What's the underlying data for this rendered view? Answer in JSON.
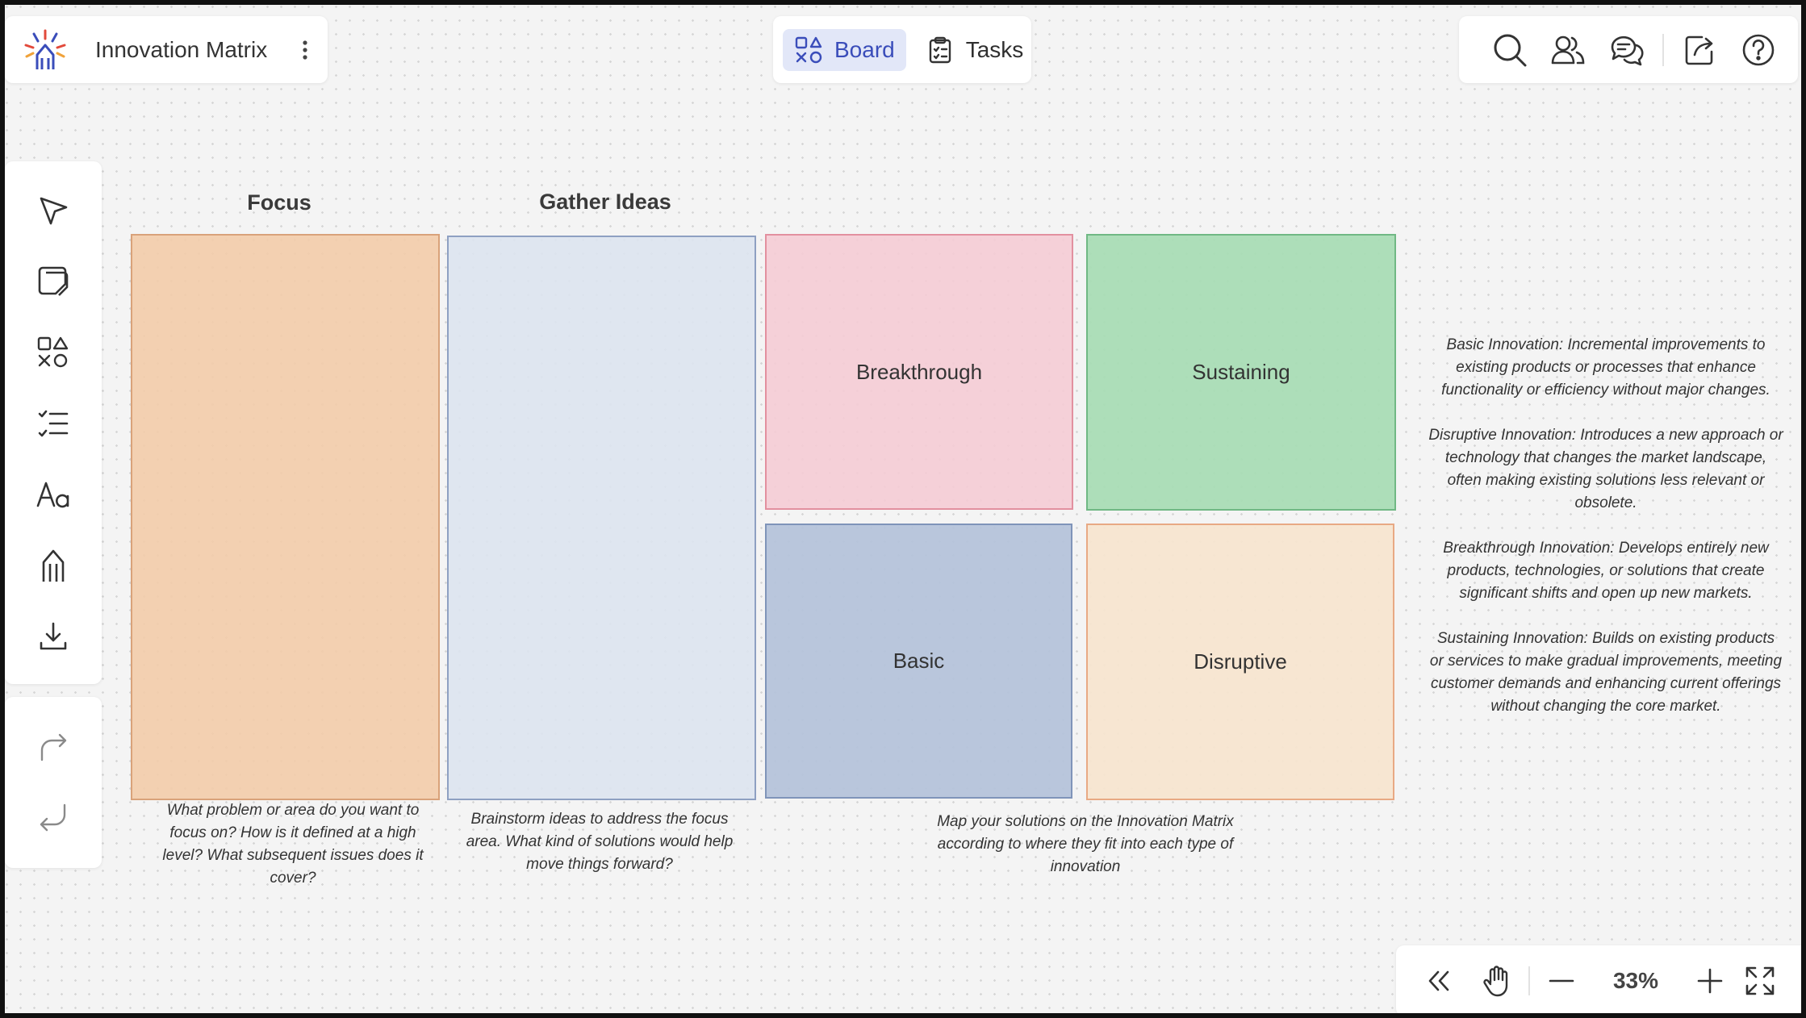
{
  "app": {
    "title": "Innovation Matrix"
  },
  "tabs": [
    {
      "label": "Board",
      "active": true
    },
    {
      "label": "Tasks",
      "active": false
    }
  ],
  "colors": {
    "accent": "#3a4dba",
    "tab_active_bg": "#e2e7f8",
    "focus_fill": "#f2ccaa",
    "gather_fill": "#dce4ef",
    "breakthrough_fill": "#f4ccd5",
    "sustaining_fill": "#a9dcb5",
    "basic_fill": "#b5c3da",
    "disruptive_fill": "#f7e5d0"
  },
  "board": {
    "headings": {
      "focus": "Focus",
      "gather": "Gather Ideas"
    },
    "matrix": {
      "breakthrough": "Breakthrough",
      "sustaining": "Sustaining",
      "basic": "Basic",
      "disruptive": "Disruptive"
    },
    "captions": {
      "focus": "What problem or area do you want to focus on? How is it defined at a high level? What subsequent issues does it cover?",
      "gather": "Brainstorm ideas to address the focus area. What kind of solutions would help move things forward?",
      "matrix": "Map your solutions on the Innovation Matrix according to where they fit into each type of innovation"
    },
    "legend": [
      "Basic Innovation: Incremental improvements to existing products or processes that enhance functionality or efficiency without major changes.",
      "Disruptive Innovation: Introduces a new approach or technology that changes the market landscape, often making existing solutions less relevant or obsolete.",
      "Breakthrough Innovation: Develops entirely new products, technologies, or solutions that create significant shifts and open up new markets.",
      "Sustaining Innovation: Builds on existing products or services to make gradual improvements, meeting customer demands and enhancing current offerings without changing the core market."
    ]
  },
  "zoom": {
    "level": "33%"
  }
}
